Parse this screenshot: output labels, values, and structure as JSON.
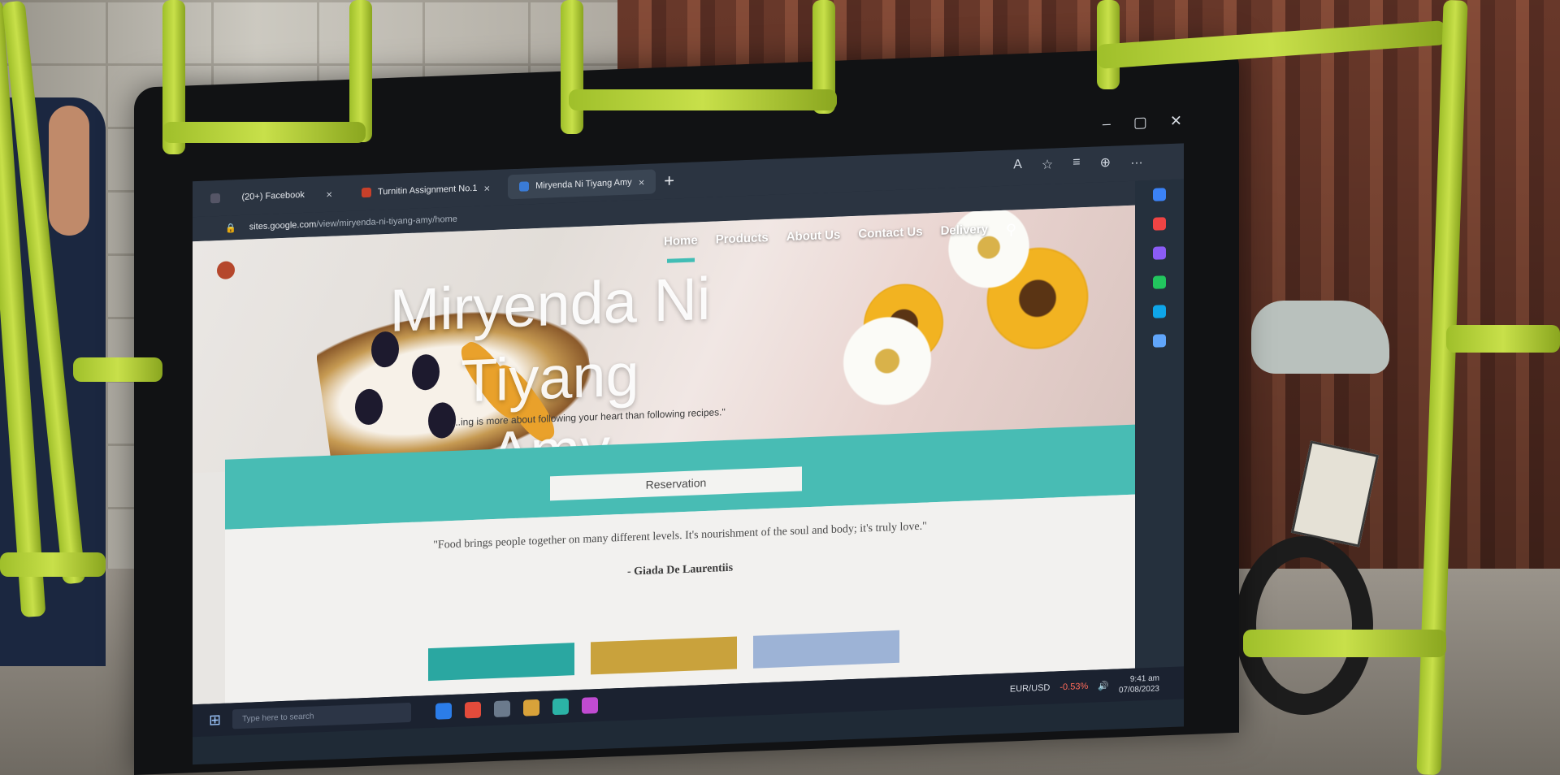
{
  "browser": {
    "tabs": [
      {
        "label": "(20+) Facebook",
        "active": false
      },
      {
        "label": "Turnitin Assignment No.1",
        "active": false
      },
      {
        "label": "Miryenda Ni Tiyang Amy",
        "active": true
      }
    ],
    "new_tab": "+",
    "close_glyph": "×",
    "url_host": "sites.google.com",
    "url_path": "/view/miryenda-ni-tiyang-amy/home",
    "window_controls": [
      "–",
      "▢",
      "✕"
    ],
    "toolbar_icons": [
      "A",
      "☆",
      "≡",
      "⊕",
      "…"
    ]
  },
  "site": {
    "nav": [
      {
        "label": "Home",
        "active": true
      },
      {
        "label": "Products"
      },
      {
        "label": "About Us"
      },
      {
        "label": "Contact Us"
      },
      {
        "label": "Delivery"
      }
    ],
    "search_icon": "⚲",
    "title_line1": "Miryenda Ni Tiyang",
    "title_line2": "Amy",
    "tagline": "...ing is more about following your heart than following recipes.\"",
    "reservation_button": "Reservation",
    "quote": "\"Food brings people together on many different levels. It's nourishment of the soul and body; it's truly love.\"",
    "quote_author": "- Giada De Laurentiis",
    "colors": {
      "accent": "#48bcb4",
      "title": "#ffffff"
    }
  },
  "taskbar": {
    "search_placeholder": "Type here to search",
    "ticker_label": "EUR/USD",
    "ticker_change": "-0.53%",
    "time": "9:41 am",
    "date": "07/08/2023"
  }
}
